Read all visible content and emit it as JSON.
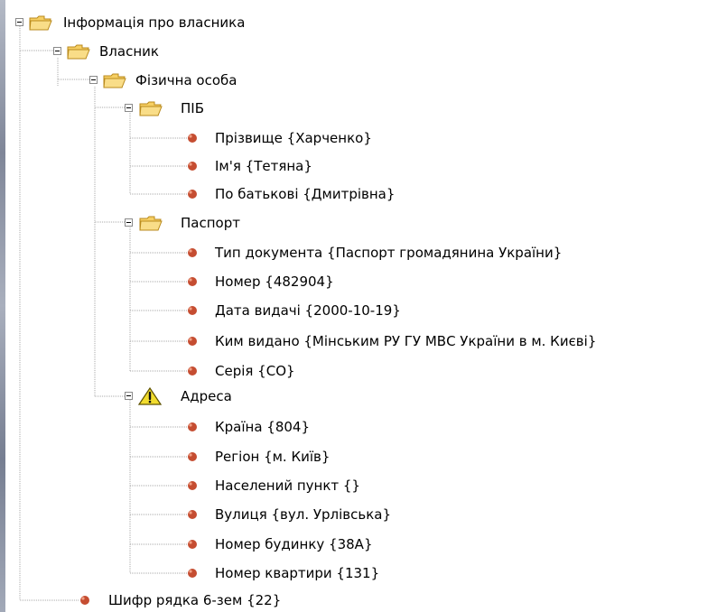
{
  "tree": {
    "root": {
      "label": "Інформація про власника",
      "icon": "open-folder-icon",
      "expanded": true
    },
    "owner": {
      "label": "Власник",
      "icon": "open-folder-icon",
      "expanded": true
    },
    "person": {
      "label": "Фізична особа",
      "icon": "open-folder-icon",
      "expanded": true
    },
    "pib": {
      "label": "ПІБ",
      "icon": "open-folder-icon",
      "expanded": true,
      "items": [
        {
          "label": "Прізвище {Харченко}",
          "icon": "red-bullet-icon"
        },
        {
          "label": "Ім'я {Тетяна}",
          "icon": "red-bullet-icon"
        },
        {
          "label": "По батькові {Дмитрівна}",
          "icon": "red-bullet-icon"
        }
      ]
    },
    "passport": {
      "label": "Паспорт",
      "icon": "open-folder-icon",
      "expanded": true,
      "items": [
        {
          "label": "Тип документа {Паспорт громадянина України}",
          "icon": "red-bullet-icon"
        },
        {
          "label": "Номер {482904}",
          "icon": "red-bullet-icon"
        },
        {
          "label": "Дата видачі {2000-10-19}",
          "icon": "red-bullet-icon"
        },
        {
          "label": "Ким видано {Мінським РУ ГУ МВС України в м. Києві}",
          "icon": "red-bullet-icon"
        },
        {
          "label": "Серія {СО}",
          "icon": "red-bullet-icon"
        }
      ]
    },
    "address": {
      "label": "Адреса",
      "icon": "warning-icon",
      "expanded": true,
      "items": [
        {
          "label": "Країна {804}",
          "icon": "red-bullet-icon"
        },
        {
          "label": "Регіон {м. Київ}",
          "icon": "red-bullet-icon"
        },
        {
          "label": "Населений пункт {}",
          "icon": "red-bullet-icon"
        },
        {
          "label": "Вулиця {вул. Урлівська}",
          "icon": "red-bullet-icon"
        },
        {
          "label": "Номер будинку {38А}",
          "icon": "red-bullet-icon"
        },
        {
          "label": "Номер квартири {131}",
          "icon": "red-bullet-icon"
        }
      ]
    },
    "row_code": {
      "label": "Шифр рядка 6-зем {22}",
      "icon": "red-bullet-icon"
    }
  },
  "colors": {
    "folder_fill": "#f6cf63",
    "folder_edge": "#b98a1c",
    "warning_fill": "#f1dc2e",
    "bullet_fill": "#c54d31",
    "tree_line": "#a8a8a8"
  }
}
